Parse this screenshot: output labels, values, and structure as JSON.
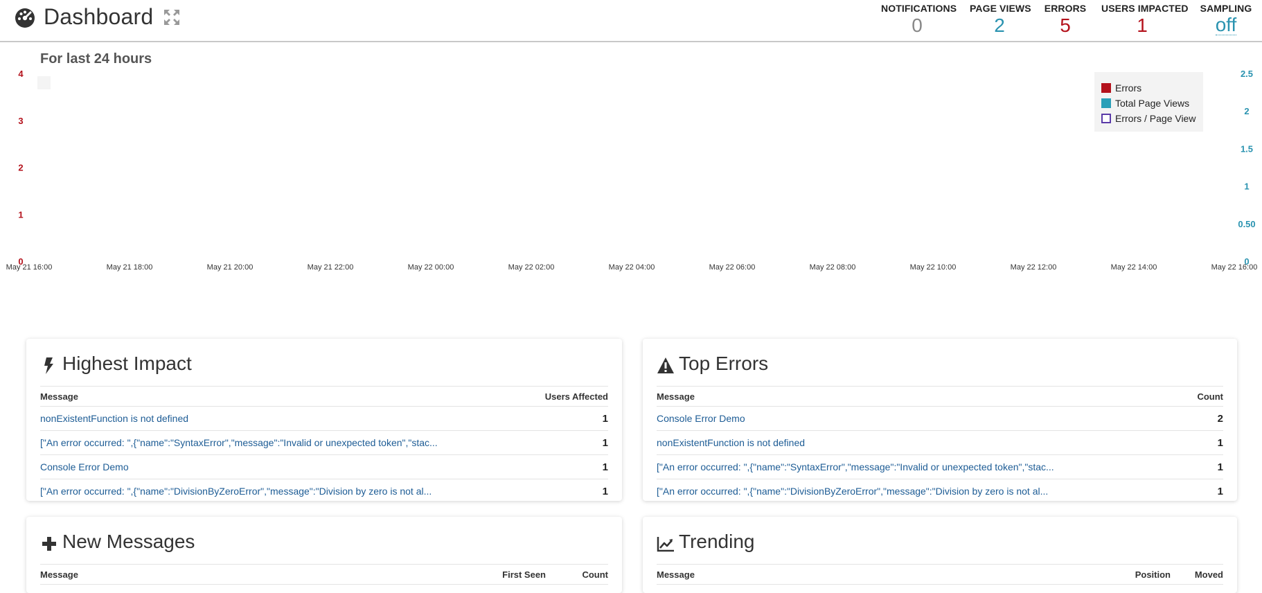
{
  "header": {
    "title": "Dashboard",
    "stats": [
      {
        "label": "NOTIFICATIONS",
        "value": "0"
      },
      {
        "label": "PAGE VIEWS",
        "value": "2"
      },
      {
        "label": "ERRORS",
        "value": "5"
      },
      {
        "label": "USERS IMPACTED",
        "value": "1"
      },
      {
        "label": "SAMPLING",
        "value": "off"
      }
    ]
  },
  "chart_data": {
    "type": "line",
    "title": "For last 24 hours",
    "x_ticks": [
      "May 21 16:00",
      "May 21 18:00",
      "May 21 20:00",
      "May 21 22:00",
      "May 22 00:00",
      "May 22 02:00",
      "May 22 04:00",
      "May 22 06:00",
      "May 22 08:00",
      "May 22 10:00",
      "May 22 12:00",
      "May 22 14:00",
      "May 22 16:00"
    ],
    "y_left_ticks": [
      "0",
      "1",
      "2",
      "3",
      "4"
    ],
    "y_left_lim": [
      0,
      4
    ],
    "y_right_ticks": [
      "0",
      "0.50",
      "1",
      "1.5",
      "2",
      "2.5"
    ],
    "y_right_lim": [
      0,
      2.5
    ],
    "legend_position": "top-right",
    "series": [
      {
        "name": "Errors",
        "color": "#b4121c",
        "values": []
      },
      {
        "name": "Total Page Views",
        "color": "#2a9fb8",
        "values": []
      },
      {
        "name": "Errors / Page View",
        "color": "#5a3aa8",
        "values": []
      }
    ]
  },
  "highest_impact": {
    "title": "Highest Impact",
    "col_message": "Message",
    "col_value": "Users Affected",
    "rows": [
      {
        "message": "nonExistentFunction is not defined",
        "value": "1"
      },
      {
        "message": "[\"An error occurred: \",{\"name\":\"SyntaxError\",\"message\":\"Invalid or unexpected token\",\"stac...",
        "value": "1"
      },
      {
        "message": "Console Error Demo",
        "value": "1"
      },
      {
        "message": "[\"An error occurred: \",{\"name\":\"DivisionByZeroError\",\"message\":\"Division by zero is not al...",
        "value": "1"
      }
    ]
  },
  "top_errors": {
    "title": "Top Errors",
    "col_message": "Message",
    "col_value": "Count",
    "rows": [
      {
        "message": "Console Error Demo",
        "value": "2"
      },
      {
        "message": "nonExistentFunction is not defined",
        "value": "1"
      },
      {
        "message": "[\"An error occurred: \",{\"name\":\"SyntaxError\",\"message\":\"Invalid or unexpected token\",\"stac...",
        "value": "1"
      },
      {
        "message": "[\"An error occurred: \",{\"name\":\"DivisionByZeroError\",\"message\":\"Division by zero is not al...",
        "value": "1"
      }
    ]
  },
  "new_messages": {
    "title": "New Messages",
    "col_message": "Message",
    "col_first_seen": "First Seen",
    "col_count": "Count"
  },
  "trending": {
    "title": "Trending",
    "col_message": "Message",
    "col_position": "Position",
    "col_moved": "Moved"
  }
}
